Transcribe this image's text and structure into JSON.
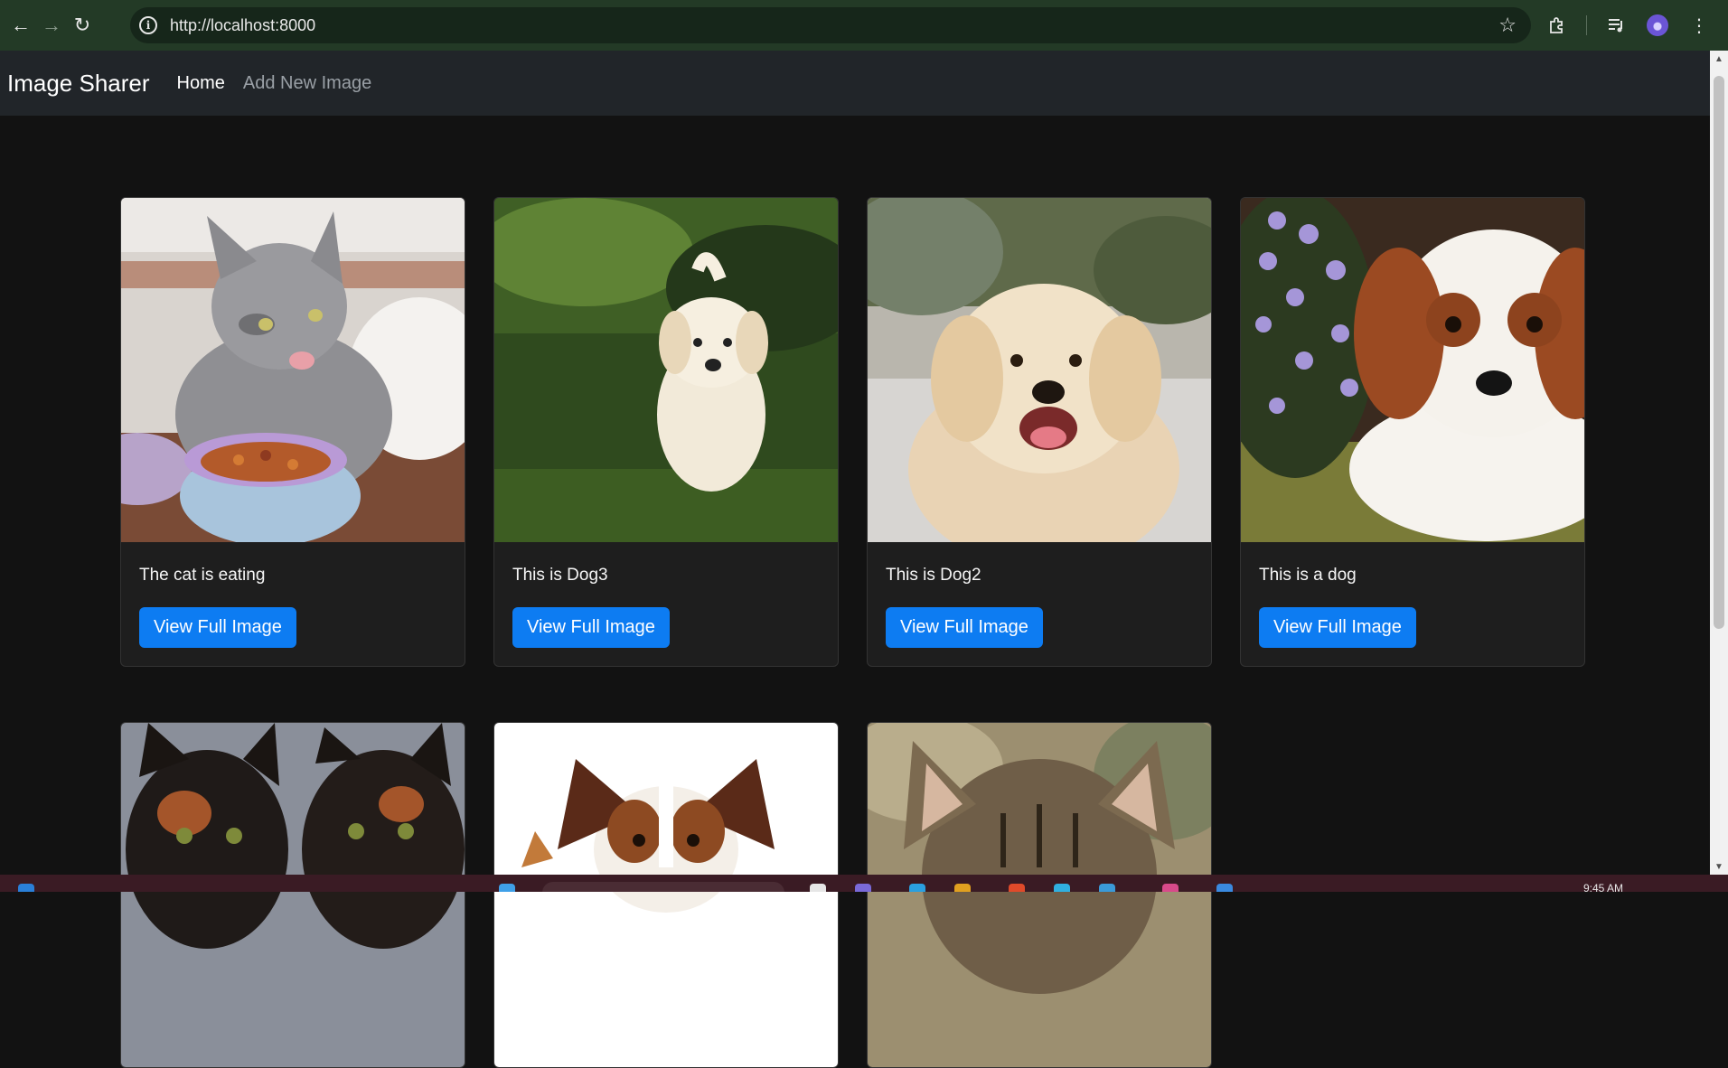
{
  "browser": {
    "url": "http://localhost:8000",
    "icons": [
      "back-icon",
      "forward-icon",
      "reload-icon",
      "site-info-icon",
      "bookmark-star-icon",
      "extensions-icon",
      "media-controls-icon",
      "profile-avatar",
      "menu-kebab-icon"
    ]
  },
  "navbar": {
    "brand": "Image Sharer",
    "links": [
      {
        "label": "Home",
        "active": true
      },
      {
        "label": "Add New Image",
        "active": false
      }
    ]
  },
  "cards": [
    {
      "caption": "The cat is eating",
      "button": "View Full Image",
      "image": "gray-cat-eating-from-bowl"
    },
    {
      "caption": "This is Dog3",
      "button": "View Full Image",
      "image": "white-puppy-in-grass"
    },
    {
      "caption": "This is Dog2",
      "button": "View Full Image",
      "image": "golden-retriever"
    },
    {
      "caption": "This is a dog",
      "button": "View Full Image",
      "image": "cavalier-spaniel-puppy-with-flowers"
    },
    {
      "caption": "",
      "button": "",
      "image": "two-tortoiseshell-kittens"
    },
    {
      "caption": "",
      "button": "",
      "image": "papillon-dog-and-kitten"
    },
    {
      "caption": "",
      "button": "",
      "image": "tabby-cat"
    }
  ],
  "taskbar": {
    "clock": "9:45 AM"
  },
  "colors": {
    "page_bg": "#121212",
    "navbar_bg": "#212529",
    "card_bg": "#1e1e1e",
    "button_bg": "#0d7cf2",
    "browser_bar": "#233a26"
  }
}
